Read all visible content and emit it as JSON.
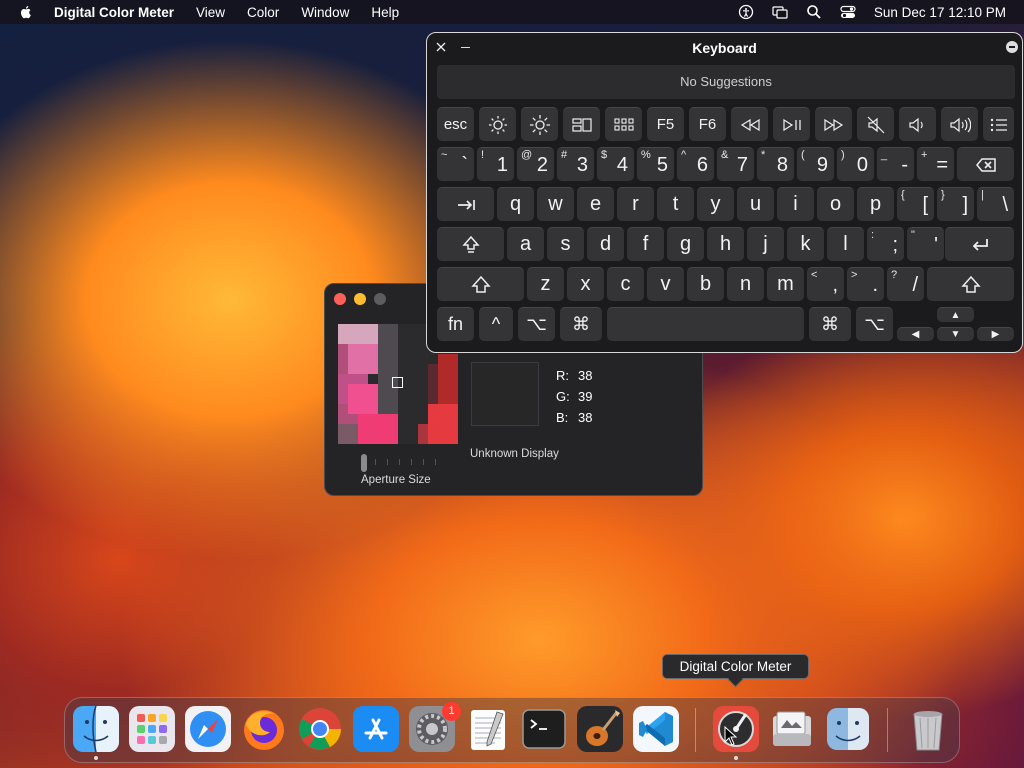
{
  "menubar": {
    "app_name": "Digital Color Meter",
    "menus": [
      "View",
      "Color",
      "Window",
      "Help"
    ],
    "status_icons": [
      "accessibility-icon",
      "screen-mirroring-icon",
      "spotlight-search-icon",
      "control-center-icon"
    ],
    "clock": "Sun Dec 17  12:10 PM"
  },
  "keyboard_viewer": {
    "title": "Keyboard",
    "suggestions": "No Suggestions",
    "function_row": {
      "esc": "esc",
      "f5": "F5",
      "f6": "F6"
    },
    "number_row": [
      {
        "sec": "~",
        "pri": "`"
      },
      {
        "sec": "!",
        "pri": "1"
      },
      {
        "sec": "@",
        "pri": "2"
      },
      {
        "sec": "#",
        "pri": "3"
      },
      {
        "sec": "$",
        "pri": "4"
      },
      {
        "sec": "%",
        "pri": "5"
      },
      {
        "sec": "^",
        "pri": "6"
      },
      {
        "sec": "&",
        "pri": "7"
      },
      {
        "sec": "*",
        "pri": "8"
      },
      {
        "sec": "(",
        "pri": "9"
      },
      {
        "sec": ")",
        "pri": "0"
      },
      {
        "sec": "_",
        "pri": "-"
      },
      {
        "sec": "+",
        "pri": "="
      }
    ],
    "row_q": [
      "q",
      "w",
      "e",
      "r",
      "t",
      "y",
      "u",
      "i",
      "o",
      "p"
    ],
    "row_q_sym": [
      {
        "sec": "{",
        "pri": "["
      },
      {
        "sec": "}",
        "pri": "]"
      },
      {
        "sec": "|",
        "pri": "\\"
      }
    ],
    "row_a": [
      "a",
      "s",
      "d",
      "f",
      "g",
      "h",
      "j",
      "k",
      "l"
    ],
    "row_a_sym": [
      {
        "sec": ":",
        "pri": ";"
      },
      {
        "sec": "\"",
        "pri": "'"
      }
    ],
    "row_z": [
      "z",
      "x",
      "c",
      "v",
      "b",
      "n",
      "m"
    ],
    "row_z_sym": [
      {
        "sec": "<",
        "pri": ","
      },
      {
        "sec": ">",
        "pri": "."
      },
      {
        "sec": "?",
        "pri": "/"
      }
    ],
    "bottom": {
      "fn": "fn",
      "control": "^",
      "option": "⌥",
      "command": "⌘"
    }
  },
  "color_meter": {
    "r_label": "R:",
    "g_label": "G:",
    "b_label": "B:",
    "r": "38",
    "g": "39",
    "b": "38",
    "display": "Unknown Display",
    "aperture_label": "Aperture Size",
    "aperture_level": 0.0,
    "sample_color": "#262726"
  },
  "tooltip": "Digital Color Meter",
  "dock": {
    "items": [
      {
        "name": "finder-icon",
        "running": true
      },
      {
        "name": "launchpad-icon",
        "running": false
      },
      {
        "name": "safari-icon",
        "running": false
      },
      {
        "name": "firefox-icon",
        "running": false
      },
      {
        "name": "chrome-icon",
        "running": false
      },
      {
        "name": "app-store-icon",
        "running": false
      },
      {
        "name": "system-settings-icon",
        "running": false,
        "badge": "1"
      },
      {
        "name": "textedit-icon",
        "running": false
      },
      {
        "name": "terminal-icon",
        "running": false
      },
      {
        "name": "garageband-icon",
        "running": false
      },
      {
        "name": "vscode-icon",
        "running": false
      },
      {
        "name": "digital-color-meter-icon",
        "running": true
      },
      {
        "name": "preview-icon",
        "running": false
      },
      {
        "name": "finder-2-icon",
        "running": false
      },
      {
        "name": "trash-icon",
        "running": false
      }
    ]
  }
}
